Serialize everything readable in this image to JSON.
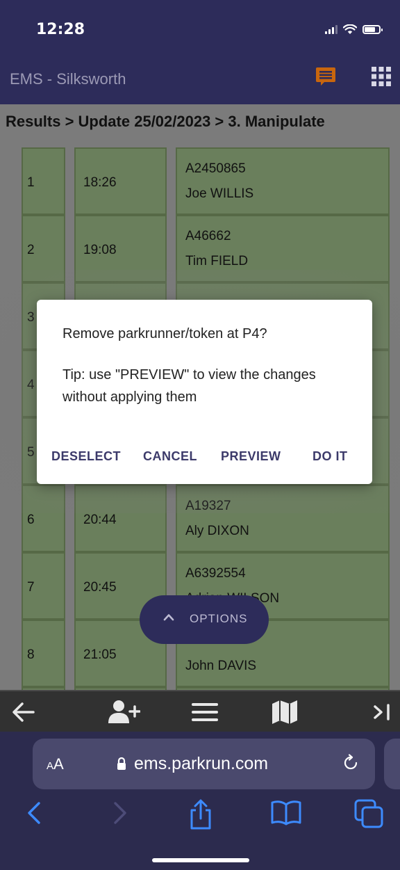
{
  "status": {
    "time": "12:28"
  },
  "header": {
    "title": "EMS - Silksworth"
  },
  "breadcrumb": "Results > Update 25/02/2023 > 3. Manipulate",
  "rows": [
    {
      "pos": "1",
      "time": "18:26",
      "id": "A2450865",
      "name": "Joe WILLIS"
    },
    {
      "pos": "2",
      "time": "19:08",
      "id": "A46662",
      "name": "Tim FIELD"
    },
    {
      "pos": "3",
      "time": "",
      "id": "",
      "name": ""
    },
    {
      "pos": "4",
      "time": "",
      "id": "",
      "name": ""
    },
    {
      "pos": "5",
      "time": "",
      "id": "",
      "name": ""
    },
    {
      "pos": "6",
      "time": "20:44",
      "id": "A19327",
      "name": "Aly DIXON"
    },
    {
      "pos": "7",
      "time": "20:45",
      "id": "A6392554",
      "name": "Adrian WILSON"
    },
    {
      "pos": "8",
      "time": "21:05",
      "id": "",
      "name": "John DAVIS"
    }
  ],
  "dialog": {
    "title": "Remove parkrunner/token at P4?",
    "tip": "Tip: use \"PREVIEW\" to view the changes without applying them",
    "buttons": {
      "deselect": "DESELECT",
      "cancel": "CANCEL",
      "preview": "PREVIEW",
      "do_it": "DO IT"
    }
  },
  "options": {
    "label": "OPTIONS"
  },
  "browser": {
    "aa_small": "A",
    "aa_large": "A",
    "url": "ems.parkrun.com"
  },
  "colors": {
    "header_bg": "#2d2c5a",
    "cell_bg": "#6a7f5c",
    "chat_icon": "#c8660e",
    "dialog_button": "#3c3a6a"
  }
}
